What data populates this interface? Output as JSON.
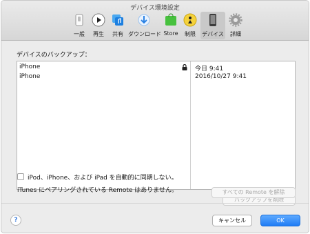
{
  "window": {
    "title": "デバイス環境設定"
  },
  "toolbar": {
    "items": [
      {
        "label": "一般",
        "icon": "general-switch-icon"
      },
      {
        "label": "再生",
        "icon": "play-icon"
      },
      {
        "label": "共有",
        "icon": "sharing-icon"
      },
      {
        "label": "ダウンロード",
        "icon": "download-icon"
      },
      {
        "label": "Store",
        "icon": "store-icon"
      },
      {
        "label": "制限",
        "icon": "restrictions-icon"
      },
      {
        "label": "デバイス",
        "icon": "device-icon",
        "selected": true
      },
      {
        "label": "詳細",
        "icon": "gear-icon"
      }
    ]
  },
  "backups": {
    "label": "デバイスのバックアップ：",
    "rows": [
      {
        "name": "iPhone",
        "date": "今日 9:41",
        "locked": true
      },
      {
        "name": "iPhone",
        "date": "2016/10/27 9:41",
        "locked": false
      }
    ],
    "delete_button": "バックアップを削除"
  },
  "sync": {
    "checkbox_label": "iPod、iPhone、および iPad を自動的に同期しない。",
    "checked": false
  },
  "remote": {
    "status": "iTunes にペアリングされている Remote はありません。",
    "unpair_button": "すべての Remote を解除"
  },
  "footer": {
    "help": "?",
    "cancel": "キャンセル",
    "ok": "OK"
  },
  "colors": {
    "accent": "#1f7cf5",
    "selected_tab": "#c9c9c9"
  }
}
